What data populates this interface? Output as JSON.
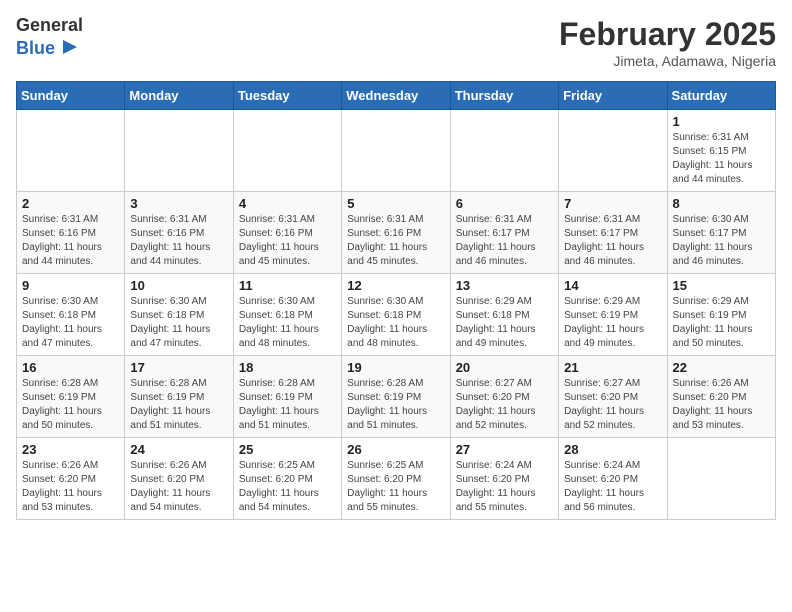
{
  "logo": {
    "general": "General",
    "blue": "Blue"
  },
  "title": "February 2025",
  "subtitle": "Jimeta, Adamawa, Nigeria",
  "weekdays": [
    "Sunday",
    "Monday",
    "Tuesday",
    "Wednesday",
    "Thursday",
    "Friday",
    "Saturday"
  ],
  "weeks": [
    [
      {
        "day": "",
        "info": ""
      },
      {
        "day": "",
        "info": ""
      },
      {
        "day": "",
        "info": ""
      },
      {
        "day": "",
        "info": ""
      },
      {
        "day": "",
        "info": ""
      },
      {
        "day": "",
        "info": ""
      },
      {
        "day": "1",
        "info": "Sunrise: 6:31 AM\nSunset: 6:15 PM\nDaylight: 11 hours\nand 44 minutes."
      }
    ],
    [
      {
        "day": "2",
        "info": "Sunrise: 6:31 AM\nSunset: 6:16 PM\nDaylight: 11 hours\nand 44 minutes."
      },
      {
        "day": "3",
        "info": "Sunrise: 6:31 AM\nSunset: 6:16 PM\nDaylight: 11 hours\nand 44 minutes."
      },
      {
        "day": "4",
        "info": "Sunrise: 6:31 AM\nSunset: 6:16 PM\nDaylight: 11 hours\nand 45 minutes."
      },
      {
        "day": "5",
        "info": "Sunrise: 6:31 AM\nSunset: 6:16 PM\nDaylight: 11 hours\nand 45 minutes."
      },
      {
        "day": "6",
        "info": "Sunrise: 6:31 AM\nSunset: 6:17 PM\nDaylight: 11 hours\nand 46 minutes."
      },
      {
        "day": "7",
        "info": "Sunrise: 6:31 AM\nSunset: 6:17 PM\nDaylight: 11 hours\nand 46 minutes."
      },
      {
        "day": "8",
        "info": "Sunrise: 6:30 AM\nSunset: 6:17 PM\nDaylight: 11 hours\nand 46 minutes."
      }
    ],
    [
      {
        "day": "9",
        "info": "Sunrise: 6:30 AM\nSunset: 6:18 PM\nDaylight: 11 hours\nand 47 minutes."
      },
      {
        "day": "10",
        "info": "Sunrise: 6:30 AM\nSunset: 6:18 PM\nDaylight: 11 hours\nand 47 minutes."
      },
      {
        "day": "11",
        "info": "Sunrise: 6:30 AM\nSunset: 6:18 PM\nDaylight: 11 hours\nand 48 minutes."
      },
      {
        "day": "12",
        "info": "Sunrise: 6:30 AM\nSunset: 6:18 PM\nDaylight: 11 hours\nand 48 minutes."
      },
      {
        "day": "13",
        "info": "Sunrise: 6:29 AM\nSunset: 6:18 PM\nDaylight: 11 hours\nand 49 minutes."
      },
      {
        "day": "14",
        "info": "Sunrise: 6:29 AM\nSunset: 6:19 PM\nDaylight: 11 hours\nand 49 minutes."
      },
      {
        "day": "15",
        "info": "Sunrise: 6:29 AM\nSunset: 6:19 PM\nDaylight: 11 hours\nand 50 minutes."
      }
    ],
    [
      {
        "day": "16",
        "info": "Sunrise: 6:28 AM\nSunset: 6:19 PM\nDaylight: 11 hours\nand 50 minutes."
      },
      {
        "day": "17",
        "info": "Sunrise: 6:28 AM\nSunset: 6:19 PM\nDaylight: 11 hours\nand 51 minutes."
      },
      {
        "day": "18",
        "info": "Sunrise: 6:28 AM\nSunset: 6:19 PM\nDaylight: 11 hours\nand 51 minutes."
      },
      {
        "day": "19",
        "info": "Sunrise: 6:28 AM\nSunset: 6:19 PM\nDaylight: 11 hours\nand 51 minutes."
      },
      {
        "day": "20",
        "info": "Sunrise: 6:27 AM\nSunset: 6:20 PM\nDaylight: 11 hours\nand 52 minutes."
      },
      {
        "day": "21",
        "info": "Sunrise: 6:27 AM\nSunset: 6:20 PM\nDaylight: 11 hours\nand 52 minutes."
      },
      {
        "day": "22",
        "info": "Sunrise: 6:26 AM\nSunset: 6:20 PM\nDaylight: 11 hours\nand 53 minutes."
      }
    ],
    [
      {
        "day": "23",
        "info": "Sunrise: 6:26 AM\nSunset: 6:20 PM\nDaylight: 11 hours\nand 53 minutes."
      },
      {
        "day": "24",
        "info": "Sunrise: 6:26 AM\nSunset: 6:20 PM\nDaylight: 11 hours\nand 54 minutes."
      },
      {
        "day": "25",
        "info": "Sunrise: 6:25 AM\nSunset: 6:20 PM\nDaylight: 11 hours\nand 54 minutes."
      },
      {
        "day": "26",
        "info": "Sunrise: 6:25 AM\nSunset: 6:20 PM\nDaylight: 11 hours\nand 55 minutes."
      },
      {
        "day": "27",
        "info": "Sunrise: 6:24 AM\nSunset: 6:20 PM\nDaylight: 11 hours\nand 55 minutes."
      },
      {
        "day": "28",
        "info": "Sunrise: 6:24 AM\nSunset: 6:20 PM\nDaylight: 11 hours\nand 56 minutes."
      },
      {
        "day": "",
        "info": ""
      }
    ]
  ]
}
